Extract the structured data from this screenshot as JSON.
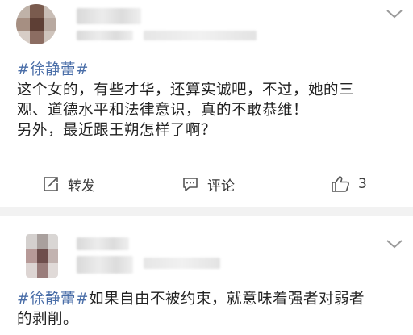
{
  "posts": [
    {
      "hashtag": "#徐静蕾#",
      "lines": [
        "这个女的，有些才华，还算实诚吧，不过，她的三",
        "观、道德水平和法律意识，真的不敢恭维！",
        "另外，最近跟王朔怎样了啊？"
      ],
      "actions": {
        "repost_label": "转发",
        "comment_label": "评论",
        "like_count": "3"
      }
    },
    {
      "hashtag": "#徐静蕾#",
      "text_after_tag": "如果自由不被约束，就意味着强者对弱者",
      "line2": "的剥削。"
    }
  ],
  "colors": {
    "hashtag": "#4a6ea8",
    "separator": "#f2f2f2"
  },
  "icons": [
    "chevron-down-icon",
    "repost-icon",
    "comment-icon",
    "like-icon"
  ]
}
